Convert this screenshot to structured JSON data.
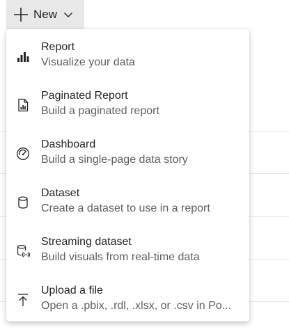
{
  "new_button": {
    "label": "New"
  },
  "menu": {
    "items": [
      {
        "title": "Report",
        "description": "Visualize your data",
        "icon": "bar-chart-icon"
      },
      {
        "title": "Paginated Report",
        "description": "Build a paginated report",
        "icon": "paginated-report-icon"
      },
      {
        "title": "Dashboard",
        "description": "Build a single-page data story",
        "icon": "dashboard-gauge-icon"
      },
      {
        "title": "Dataset",
        "description": "Create a dataset to use in a report",
        "icon": "database-icon"
      },
      {
        "title": "Streaming dataset",
        "description": "Build visuals from real-time data",
        "icon": "streaming-database-icon"
      },
      {
        "title": "Upload a file",
        "description": "Open a .pbix, .rdl, .xlsx, or .csv in Po...",
        "icon": "upload-icon"
      }
    ]
  },
  "colors": {
    "button_bg": "#e8e8e8",
    "text_primary": "#252423",
    "text_secondary": "#605e5c",
    "separator": "#e6e6e6"
  }
}
